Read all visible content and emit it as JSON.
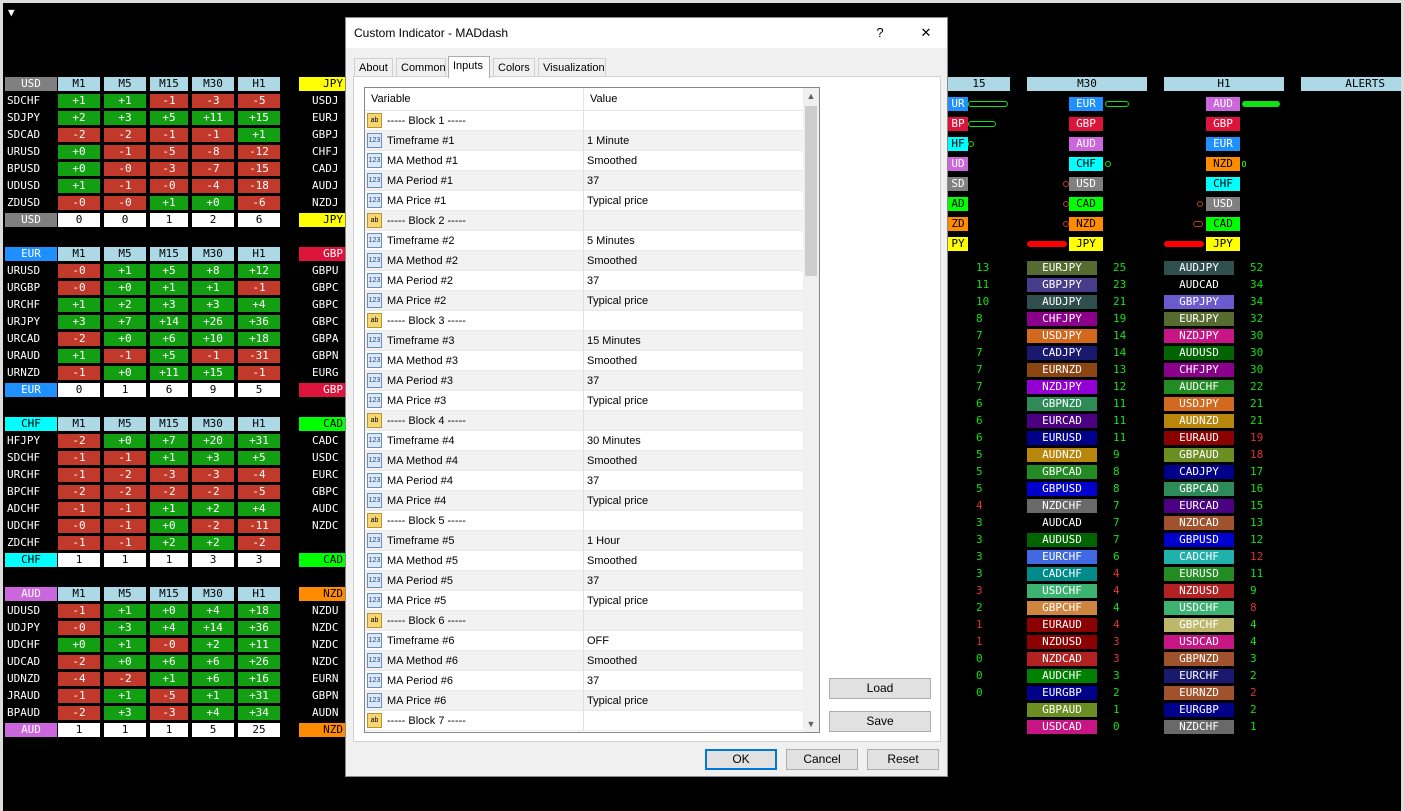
{
  "colors": {
    "pos": "#12a012",
    "neg": "#c0392b",
    "header": "#add8e6",
    "USD": "#808080",
    "EUR": "#1e90ff",
    "CHF": "#00ffff",
    "AUD": "#cc66dd",
    "JPY": "#ffff00",
    "GBP": "#dc143c",
    "CAD": "#00ff00",
    "NZD": "#ff8c00"
  },
  "left_panels": [
    {
      "label": "USD",
      "headers": [
        "M1",
        "M5",
        "M15",
        "M30",
        "H1"
      ],
      "rows": [
        [
          "SDCHF",
          "+1",
          "+1",
          "-1",
          "-3",
          "-5"
        ],
        [
          "SDJPY",
          "+2",
          "+3",
          "+5",
          "+11",
          "+15"
        ],
        [
          "SDCAD",
          "-2",
          "-2",
          "-1",
          "-1",
          "+1"
        ],
        [
          "URUSD",
          "+0",
          "-1",
          "-5",
          "-8",
          "-12"
        ],
        [
          "BPUSD",
          "+0",
          "-0",
          "-3",
          "-7",
          "-15"
        ],
        [
          "UDUSD",
          "+1",
          "-1",
          "-0",
          "-4",
          "-18"
        ],
        [
          "ZDUSD",
          "-0",
          "-0",
          "+1",
          "+0",
          "-6"
        ]
      ],
      "footer": [
        "USD",
        "0",
        "0",
        "1",
        "2",
        "6"
      ]
    },
    {
      "label": "EUR",
      "headers": [
        "M1",
        "M5",
        "M15",
        "M30",
        "H1"
      ],
      "rows": [
        [
          "URUSD",
          "-0",
          "+1",
          "+5",
          "+8",
          "+12"
        ],
        [
          "URGBP",
          "-0",
          "+0",
          "+1",
          "+1",
          "-1"
        ],
        [
          "URCHF",
          "+1",
          "+2",
          "+3",
          "+3",
          "+4"
        ],
        [
          "URJPY",
          "+3",
          "+7",
          "+14",
          "+26",
          "+36"
        ],
        [
          "URCAD",
          "-2",
          "+0",
          "+6",
          "+10",
          "+18"
        ],
        [
          "URAUD",
          "+1",
          "-1",
          "+5",
          "-1",
          "-31"
        ],
        [
          "URNZD",
          "-1",
          "+0",
          "+11",
          "+15",
          "-1"
        ]
      ],
      "footer": [
        "EUR",
        "0",
        "1",
        "6",
        "9",
        "5"
      ]
    },
    {
      "label": "CHF",
      "headers": [
        "M1",
        "M5",
        "M15",
        "M30",
        "H1"
      ],
      "rows": [
        [
          "HFJPY",
          "-2",
          "+0",
          "+7",
          "+20",
          "+31"
        ],
        [
          "SDCHF",
          "-1",
          "-1",
          "+1",
          "+3",
          "+5"
        ],
        [
          "URCHF",
          "-1",
          "-2",
          "-3",
          "-3",
          "-4"
        ],
        [
          "BPCHF",
          "-2",
          "-2",
          "-2",
          "-2",
          "-5"
        ],
        [
          "ADCHF",
          "-1",
          "-1",
          "+1",
          "+2",
          "+4"
        ],
        [
          "UDCHF",
          "-0",
          "-1",
          "+0",
          "-2",
          "-11"
        ],
        [
          "ZDCHF",
          "-1",
          "-1",
          "+2",
          "+2",
          "-2"
        ]
      ],
      "footer": [
        "CHF",
        "1",
        "1",
        "1",
        "3",
        "3"
      ]
    },
    {
      "label": "AUD",
      "headers": [
        "M1",
        "M5",
        "M15",
        "M30",
        "H1"
      ],
      "rows": [
        [
          "UDUSD",
          "-1",
          "+1",
          "+0",
          "+4",
          "+18"
        ],
        [
          "UDJPY",
          "-0",
          "+3",
          "+4",
          "+14",
          "+36"
        ],
        [
          "UDCHF",
          "+0",
          "+1",
          "-0",
          "+2",
          "+11"
        ],
        [
          "UDCAD",
          "-2",
          "+0",
          "+6",
          "+6",
          "+26"
        ],
        [
          "UDNZD",
          "-4",
          "-2",
          "+1",
          "+6",
          "+16"
        ],
        [
          "JRAUD",
          "-1",
          "+1",
          "-5",
          "+1",
          "+31"
        ],
        [
          "BPAUD",
          "-2",
          "+3",
          "-3",
          "+4",
          "+34"
        ]
      ],
      "footer": [
        "AUD",
        "1",
        "1",
        "1",
        "5",
        "25"
      ]
    }
  ],
  "right_cut_labels": [
    {
      "label": "JPY",
      "rows": [
        "USDJ",
        "EURJ",
        "GBPJ",
        "CHFJ",
        "CADJ",
        "AUDJ",
        "NZDJ"
      ],
      "footer": "JPY"
    },
    {
      "label": "GBP",
      "rows": [
        "GBPU",
        "GBPC",
        "GBPC",
        "GBPC",
        "GBPA",
        "GBPN",
        "EURG"
      ],
      "footer": "GBP"
    },
    {
      "label": "CAD",
      "rows": [
        "CADC",
        "USDC",
        "EURC",
        "GBPC",
        "AUDC",
        "NZDC"
      ],
      "footer": "CAD"
    },
    {
      "label": "NZD",
      "rows": [
        "NZDU",
        "NZDC",
        "NZDC",
        "NZDC",
        "EURN",
        "GBPN",
        "AUDN"
      ],
      "footer": "NZD"
    }
  ],
  "strength_headers": {
    "m15": "15",
    "m30": "M30",
    "h1": "H1",
    "alerts": "ALERTS"
  },
  "strength_m15": [
    "UR",
    "BP",
    "HF",
    "UD",
    "SD",
    "AD",
    "ZD",
    "PY"
  ],
  "strength_m30": [
    "EUR",
    "GBP",
    "AUD",
    "CHF",
    "USD",
    "CAD",
    "NZD",
    "JPY"
  ],
  "strength_h1": [
    "AUD",
    "GBP",
    "EUR",
    "NZD",
    "CHF",
    "USD",
    "CAD",
    "JPY"
  ],
  "rank_m15": [
    "13",
    "11",
    "10",
    "8",
    "7",
    "7",
    "7",
    "7",
    "6",
    "6",
    "6",
    "5",
    "5",
    "5",
    "4",
    "3",
    "3",
    "3",
    "3",
    "3",
    "2",
    "1",
    "1",
    "0",
    "0",
    "0"
  ],
  "rank_m30": [
    [
      "EURJPY",
      "25"
    ],
    [
      "GBPJPY",
      "23"
    ],
    [
      "AUDJPY",
      "21"
    ],
    [
      "CHFJPY",
      "19"
    ],
    [
      "USDJPY",
      "14"
    ],
    [
      "CADJPY",
      "14"
    ],
    [
      "EURNZD",
      "13"
    ],
    [
      "NZDJPY",
      "12"
    ],
    [
      "GBPNZD",
      "11"
    ],
    [
      "EURCAD",
      "11"
    ],
    [
      "EURUSD",
      "11"
    ],
    [
      "AUDNZD",
      "9"
    ],
    [
      "GBPCAD",
      "8"
    ],
    [
      "GBPUSD",
      "8"
    ],
    [
      "NZDCHF",
      "7"
    ],
    [
      "AUDCAD",
      "7"
    ],
    [
      "AUDUSD",
      "7"
    ],
    [
      "EURCHF",
      "6"
    ],
    [
      "CADCHF",
      "4"
    ],
    [
      "USDCHF",
      "4"
    ],
    [
      "GBPCHF",
      "4"
    ],
    [
      "EURAUD",
      "4"
    ],
    [
      "NZDUSD",
      "3"
    ],
    [
      "NZDCAD",
      "3"
    ],
    [
      "AUDCHF",
      "3"
    ],
    [
      "EURGBP",
      "2"
    ],
    [
      "GBPAUD",
      "1"
    ],
    [
      "USDCAD",
      "0"
    ]
  ],
  "rank_h1": [
    [
      "AUDJPY",
      "52"
    ],
    [
      "AUDCAD",
      "34"
    ],
    [
      "GBPJPY",
      "34"
    ],
    [
      "EURJPY",
      "32"
    ],
    [
      "NZDJPY",
      "30"
    ],
    [
      "AUDUSD",
      "30"
    ],
    [
      "CHFJPY",
      "30"
    ],
    [
      "AUDCHF",
      "22"
    ],
    [
      "USDJPY",
      "21"
    ],
    [
      "AUDNZD",
      "21"
    ],
    [
      "EURAUD",
      "19"
    ],
    [
      "GBPAUD",
      "18"
    ],
    [
      "CADJPY",
      "17"
    ],
    [
      "GBPCAD",
      "16"
    ],
    [
      "EURCAD",
      "15"
    ],
    [
      "NZDCAD",
      "13"
    ],
    [
      "GBPUSD",
      "12"
    ],
    [
      "CADCHF",
      "12"
    ],
    [
      "EURUSD",
      "11"
    ],
    [
      "NZDUSD",
      "9"
    ],
    [
      "USDCHF",
      "8"
    ],
    [
      "GBPCHF",
      "4"
    ],
    [
      "USDCAD",
      "4"
    ],
    [
      "GBPNZD",
      "3"
    ],
    [
      "EURCHF",
      "2"
    ],
    [
      "EURNZD",
      "2"
    ],
    [
      "EURGBP",
      "2"
    ],
    [
      "NZDCHF",
      "1"
    ]
  ],
  "dialog": {
    "title": "Custom Indicator - MADdash",
    "help": "?",
    "close": "✕",
    "tabs": [
      "About",
      "Common",
      "Inputs",
      "Colors",
      "Visualization"
    ],
    "active_tab": "Inputs",
    "columns": {
      "variable": "Variable",
      "value": "Value"
    },
    "rows": [
      {
        "icon": "ab",
        "var": "----- Block 1 -----",
        "val": ""
      },
      {
        "icon": "123",
        "var": "Timeframe #1",
        "val": "1 Minute"
      },
      {
        "icon": "123",
        "var": "MA Method #1",
        "val": "Smoothed"
      },
      {
        "icon": "123",
        "var": "MA Period #1",
        "val": "37"
      },
      {
        "icon": "123",
        "var": "MA Price #1",
        "val": "Typical price"
      },
      {
        "icon": "ab",
        "var": "----- Block 2 -----",
        "val": ""
      },
      {
        "icon": "123",
        "var": "Timeframe #2",
        "val": "5 Minutes"
      },
      {
        "icon": "123",
        "var": "MA Method #2",
        "val": "Smoothed"
      },
      {
        "icon": "123",
        "var": "MA Period #2",
        "val": "37"
      },
      {
        "icon": "123",
        "var": "MA Price #2",
        "val": "Typical price"
      },
      {
        "icon": "ab",
        "var": "----- Block 3 -----",
        "val": ""
      },
      {
        "icon": "123",
        "var": "Timeframe #3",
        "val": "15 Minutes"
      },
      {
        "icon": "123",
        "var": "MA Method #3",
        "val": "Smoothed"
      },
      {
        "icon": "123",
        "var": "MA Period #3",
        "val": "37"
      },
      {
        "icon": "123",
        "var": "MA Price #3",
        "val": "Typical price"
      },
      {
        "icon": "ab",
        "var": "----- Block 4 -----",
        "val": ""
      },
      {
        "icon": "123",
        "var": "Timeframe #4",
        "val": "30 Minutes"
      },
      {
        "icon": "123",
        "var": "MA Method #4",
        "val": "Smoothed"
      },
      {
        "icon": "123",
        "var": "MA Period #4",
        "val": "37"
      },
      {
        "icon": "123",
        "var": "MA Price #4",
        "val": "Typical price"
      },
      {
        "icon": "ab",
        "var": "----- Block 5 -----",
        "val": ""
      },
      {
        "icon": "123",
        "var": "Timeframe #5",
        "val": "1 Hour"
      },
      {
        "icon": "123",
        "var": "MA Method #5",
        "val": "Smoothed"
      },
      {
        "icon": "123",
        "var": "MA Period #5",
        "val": "37"
      },
      {
        "icon": "123",
        "var": "MA Price #5",
        "val": "Typical price"
      },
      {
        "icon": "ab",
        "var": "----- Block 6 -----",
        "val": ""
      },
      {
        "icon": "123",
        "var": "Timeframe #6",
        "val": "OFF"
      },
      {
        "icon": "123",
        "var": "MA Method #6",
        "val": "Smoothed"
      },
      {
        "icon": "123",
        "var": "MA Period #6",
        "val": "37"
      },
      {
        "icon": "123",
        "var": "MA Price #6",
        "val": "Typical price"
      },
      {
        "icon": "ab",
        "var": "----- Block 7 -----",
        "val": ""
      }
    ],
    "load": "Load",
    "save": "Save",
    "ok": "OK",
    "cancel": "Cancel",
    "reset": "Reset"
  }
}
